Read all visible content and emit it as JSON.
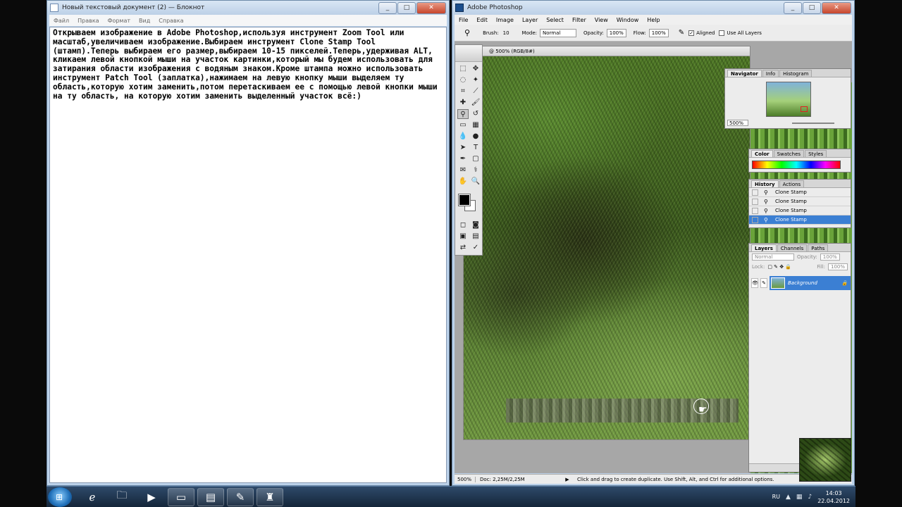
{
  "notepad": {
    "title": "Новый текстовый документ (2) — Блокнот",
    "menu": [
      "Файл",
      "Правка",
      "Формат",
      "Вид",
      "Справка"
    ],
    "text": "Открываем изображение в Adobe Photoshop,используя инструмент Zoom Tool или масштаб,увеличиваем изображение.Выбираем инструмент Clone Stamp Tool (штамп).Теперь выбираем его размер,выбираем 10-15 пикселей.Теперь,удерживая ALT, кликаем левой кнопкой мыши на участок картинки,который мы будем использовать для затирания области изображения с водяным знаком.Кроме штампа можно использовать инструмент Patch Tool (заплатка),нажимаем на левую кнопку мыши выделяем ту область,которую хотим заменить,потом перетаскиваем ее с помощью левой кнопки мыши на ту область, на которую хотим заменить выделенный участок всё:)"
  },
  "photoshop": {
    "title": "Adobe Photoshop",
    "menu": [
      "File",
      "Edit",
      "Image",
      "Layer",
      "Select",
      "Filter",
      "View",
      "Window",
      "Help"
    ],
    "options": {
      "brush_label": "Brush:",
      "brush_size": "10",
      "mode_label": "Mode:",
      "mode_value": "Normal",
      "opacity_label": "Opacity:",
      "opacity_value": "100%",
      "flow_label": "Flow:",
      "flow_value": "100%",
      "aligned_label": "Aligned",
      "aligned_checked": true,
      "use_all_layers_label": "Use All Layers",
      "use_all_layers_checked": false
    },
    "document_title": "@ 500% (RGB/8#)",
    "navigator": {
      "tabs": [
        "Navigator",
        "Info",
        "Histogram"
      ],
      "zoom": "500%"
    },
    "color_palette": {
      "tabs": [
        "Color",
        "Swatches",
        "Styles"
      ]
    },
    "history": {
      "tabs": [
        "History",
        "Actions"
      ],
      "items": [
        "Clone Stamp",
        "Clone Stamp",
        "Clone Stamp",
        "Clone Stamp"
      ],
      "selected_index": 3
    },
    "layers": {
      "tabs": [
        "Layers",
        "Channels",
        "Paths"
      ],
      "blend_mode": "Normal",
      "opacity_label": "Opacity:",
      "opacity_value": "100%",
      "lock_label": "Lock:",
      "fill_label": "Fill:",
      "fill_value": "100%",
      "layer_name": "Background"
    },
    "status": {
      "zoom": "500%",
      "doc": "Doc: 2,25M/2,25M",
      "hint": "Click and drag to create duplicate.  Use Shift, Alt, and Ctrl for additional options."
    }
  },
  "taskbar": {
    "language": "RU",
    "time": "14:03",
    "date": "22.04.2012",
    "apps": [
      "internet-explorer",
      "file-explorer",
      "media-player",
      "windows-explorer-window",
      "notepad-file",
      "paint-app",
      "photoshop-app"
    ]
  }
}
